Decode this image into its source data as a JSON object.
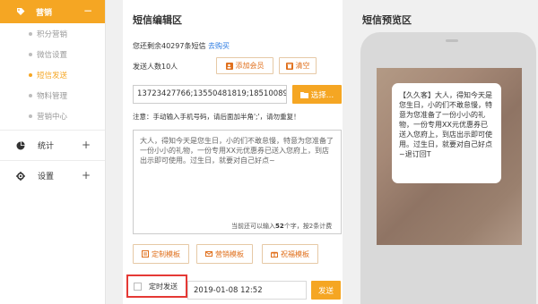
{
  "sidebar": {
    "head": {
      "label": "营销",
      "toggle": "−"
    },
    "items": [
      {
        "label": "积分营销",
        "active": false
      },
      {
        "label": "微信设置",
        "active": false
      },
      {
        "label": "短信发送",
        "active": true
      },
      {
        "label": "物料管理",
        "active": false
      },
      {
        "label": "营销中心",
        "active": false
      }
    ],
    "sections": [
      {
        "label": "统计",
        "toggle": "+"
      },
      {
        "label": "设置",
        "toggle": "+"
      }
    ]
  },
  "editor": {
    "title": "短信编辑区",
    "remaining_prefix": "您还剩余40297条短信",
    "buy_link": "去购买",
    "recipients": "发送人数10人",
    "add_member": "添加会员",
    "clear": "清空",
    "phone_numbers": "13723427766;13550481819;18510089",
    "select_button": "选择…",
    "notice": "注意：手动输入手机号码，请后面加半角';'，请勿重复！",
    "message": "大人，得知今天是您生日，小的们不敢怠慢，特意为您准备了一份小小的礼物，一份专用XX元优惠券已送入您府上，到店出示即可使用。过生日，就要对自己好点~",
    "counter_prefix": "当前还可以输入",
    "counter_num": "52",
    "counter_suffix": "个字，按2条计费",
    "templates": [
      "定制模板",
      "营销模板",
      "祝福模板"
    ],
    "scheduled_label": "定时发送",
    "scheduled_time": "2019-01-08 12:52",
    "send": "发送"
  },
  "preview": {
    "title": "短信预览区",
    "message": "【久久客】大人，得知今天是您生日，小的们不敢怠慢，特意为您准备了一份小小的礼物，一份专用XX元优惠券已送入您府上，到店出示即可使用。过生日，就要对自己好点~退订回T"
  },
  "colors": {
    "accent": "#f5a623",
    "link": "#2a7ae2",
    "highlight_border": "#e53935"
  }
}
